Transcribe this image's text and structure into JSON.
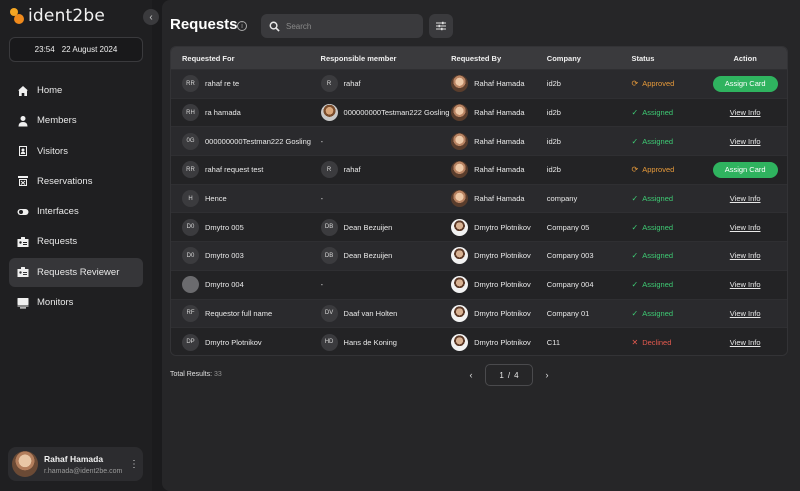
{
  "brand": {
    "name": "ident2be"
  },
  "sidebar": {
    "time": "23:54",
    "date": "22 August 2024",
    "nav": [
      {
        "label": "Home",
        "icon": "home-icon"
      },
      {
        "label": "Members",
        "icon": "person-icon"
      },
      {
        "label": "Visitors",
        "icon": "visitor-badge-icon"
      },
      {
        "label": "Reservations",
        "icon": "reservation-icon"
      },
      {
        "label": "Interfaces",
        "icon": "toggle-icon"
      },
      {
        "label": "Requests",
        "icon": "id-card-icon"
      },
      {
        "label": "Requests Reviewer",
        "icon": "id-card-icon"
      },
      {
        "label": "Monitors",
        "icon": "monitor-icon"
      }
    ],
    "active": "Requests Reviewer",
    "user": {
      "name": "Rahaf Hamada",
      "email": "r.hamada@ident2be.com"
    }
  },
  "main": {
    "title": "Requests",
    "search_placeholder": "Search",
    "columns": [
      "Requested For",
      "Responsible member",
      "Requested By",
      "Company",
      "Status",
      "Action"
    ],
    "rows": [
      {
        "for_initials": "RR",
        "for": "rahaf re te",
        "resp_initials": "R",
        "resp": "rahaf",
        "by": "Rahaf Hamada",
        "company": "id2b",
        "status": "Approved",
        "action": "Assign Card"
      },
      {
        "for_initials": "RH",
        "for": "ra hamada",
        "resp_initials": "",
        "resp": "000000000Testman222 Gosling",
        "by": "Rahaf Hamada",
        "company": "id2b",
        "status": "Assigned",
        "action": "View Info"
      },
      {
        "for_initials": "0G",
        "for": "000000000Testman222 Gosling",
        "resp_initials": "",
        "resp": "-",
        "by": "Rahaf Hamada",
        "company": "id2b",
        "status": "Assigned",
        "action": "View Info"
      },
      {
        "for_initials": "RR",
        "for": "rahaf request test",
        "resp_initials": "R",
        "resp": "rahaf",
        "by": "Rahaf Hamada",
        "company": "id2b",
        "status": "Approved",
        "action": "Assign Card"
      },
      {
        "for_initials": "H",
        "for": "Hence",
        "resp_initials": "",
        "resp": "-",
        "by": "Rahaf Hamada",
        "company": "company",
        "status": "Assigned",
        "action": "View Info"
      },
      {
        "for_initials": "D0",
        "for": "Dmytro 005",
        "resp_initials": "DB",
        "resp": "Dean Bezuijen",
        "by": "Dmytro Plotnikov",
        "company": "Company 05",
        "status": "Assigned",
        "action": "View Info"
      },
      {
        "for_initials": "D0",
        "for": "Dmytro 003",
        "resp_initials": "DB",
        "resp": "Dean Bezuijen",
        "by": "Dmytro Plotnikov",
        "company": "Company 003",
        "status": "Assigned",
        "action": "View Info"
      },
      {
        "for_initials": "",
        "for": "Dmytro 004",
        "resp_initials": "",
        "resp": "-",
        "by": "Dmytro Plotnikov",
        "company": "Company 004",
        "status": "Assigned",
        "action": "View Info"
      },
      {
        "for_initials": "RF",
        "for": "Requestor full name",
        "resp_initials": "DV",
        "resp": "Daaf van Holten",
        "by": "Dmytro Plotnikov",
        "company": "Company 01",
        "status": "Assigned",
        "action": "View Info"
      },
      {
        "for_initials": "DP",
        "for": "Dmytro Plotnikov",
        "resp_initials": "HD",
        "resp": "Hans de Koning",
        "by": "Dmytro Plotnikov",
        "company": "C11",
        "status": "Declined",
        "action": "View Info"
      }
    ],
    "total_label": "Total Results:",
    "total_count": "33",
    "page_current": "1",
    "page_sep": "/",
    "page_total": "4"
  },
  "colors": {
    "approved": "#e79a3a",
    "assigned": "#3ecb74",
    "declined": "#e45a4f",
    "assign_button": "#2fb35f"
  }
}
